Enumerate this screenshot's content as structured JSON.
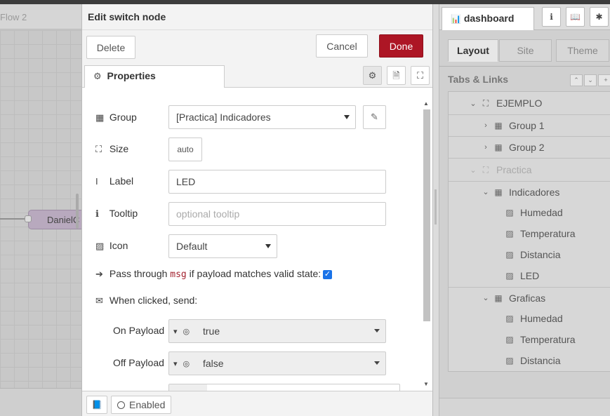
{
  "workspace": {
    "flow_tab": "Flow 2",
    "node_label": "DanielC"
  },
  "dialog": {
    "title": "Edit switch node",
    "delete_label": "Delete",
    "cancel_label": "Cancel",
    "done_label": "Done",
    "properties_tab": "Properties",
    "group": {
      "label": "Group",
      "value": "[Practica] Indicadores"
    },
    "size": {
      "label": "Size",
      "value": "auto"
    },
    "label_field": {
      "label": "Label",
      "value": "LED"
    },
    "tooltip": {
      "label": "Tooltip",
      "placeholder": "optional tooltip"
    },
    "icon": {
      "label": "Icon",
      "value": "Default"
    },
    "pass_through": {
      "prefix": "Pass through",
      "code": "msg",
      "suffix": "if payload matches valid state:",
      "checked": true
    },
    "when_clicked": "When clicked, send:",
    "on_payload": {
      "label": "On Payload",
      "value": "true"
    },
    "off_payload": {
      "label": "Off Payload",
      "value": "false"
    },
    "enabled_label": "Enabled"
  },
  "sidebar": {
    "tab_label": "dashboard",
    "subtabs": [
      "Layout",
      "Site",
      "Theme"
    ],
    "section_title": "Tabs & Links",
    "tree": [
      {
        "label": "EJEMPLO",
        "kind": "tab",
        "expanded": true,
        "dim": false
      },
      {
        "label": "Group 1",
        "kind": "group",
        "expanded": false,
        "dim": false
      },
      {
        "label": "Group 2",
        "kind": "group",
        "expanded": false,
        "dim": false
      },
      {
        "label": "Practica",
        "kind": "tab",
        "expanded": true,
        "dim": true
      },
      {
        "label": "Indicadores",
        "kind": "group",
        "expanded": true,
        "dim": false
      },
      {
        "label": "Humedad",
        "kind": "widget",
        "dim": false
      },
      {
        "label": "Temperatura",
        "kind": "widget",
        "dim": false
      },
      {
        "label": "Distancia",
        "kind": "widget",
        "dim": false
      },
      {
        "label": "LED",
        "kind": "widget",
        "dim": false
      },
      {
        "label": "Graficas",
        "kind": "group",
        "expanded": true,
        "dim": false
      },
      {
        "label": "Humedad",
        "kind": "widget",
        "dim": false
      },
      {
        "label": "Temperatura",
        "kind": "widget",
        "dim": false
      },
      {
        "label": "Distancia",
        "kind": "widget",
        "dim": false
      }
    ]
  },
  "colors": {
    "done_button": "#ad1625",
    "checkbox": "#1a73e8",
    "msg_code": "#a3222f"
  }
}
